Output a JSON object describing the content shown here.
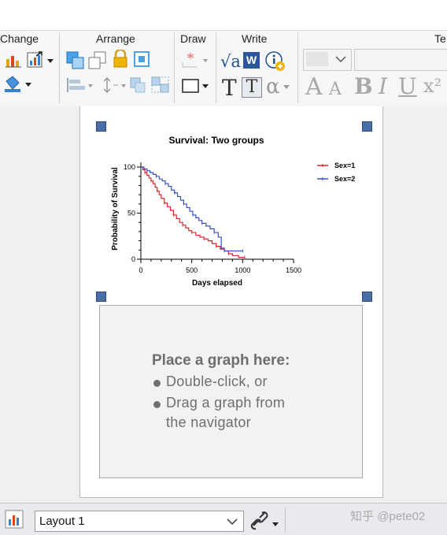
{
  "ribbon": {
    "groups": {
      "change": "Change",
      "arrange": "Arrange",
      "draw": "Draw",
      "write": "Write",
      "text": "Te"
    },
    "write_buttons": {
      "sqrt": "√a",
      "word": "W",
      "info": "i"
    },
    "text_buttons": {
      "big_t": "T",
      "boxed_t": "T",
      "alpha": "α",
      "grow_a": "A",
      "shrink_a": "A",
      "bold": "B",
      "italic": "I",
      "underline": "U",
      "superscript": "x²"
    }
  },
  "graph": {
    "title": "Survival: Two groups",
    "legend": [
      {
        "label": "Sex=1",
        "color": "#d62728"
      },
      {
        "label": "Sex=2",
        "color": "#3b4fc4"
      }
    ]
  },
  "chart_data": {
    "type": "line",
    "title": "Survival: Two groups",
    "xlabel": "Days elapsed",
    "ylabel": "Probability of Survival",
    "xlim": [
      0,
      1500
    ],
    "ylim": [
      0,
      100
    ],
    "xticks": [
      0,
      500,
      1000,
      1500
    ],
    "yticks": [
      0,
      50,
      100
    ],
    "legend_position": "top-right",
    "step": true,
    "series": [
      {
        "name": "Sex=1",
        "color": "#d62728",
        "x": [
          0,
          20,
          40,
          60,
          80,
          100,
          120,
          140,
          160,
          180,
          200,
          230,
          260,
          290,
          320,
          350,
          380,
          410,
          440,
          470,
          500,
          540,
          580,
          620,
          660,
          700,
          740,
          780,
          820,
          860,
          900,
          960,
          1020
        ],
        "y": [
          100,
          97,
          94,
          91,
          88,
          85,
          82,
          78,
          74,
          70,
          66,
          61,
          57,
          53,
          48,
          44,
          40,
          37,
          34,
          31,
          29,
          26,
          24,
          22,
          20,
          17,
          14,
          11,
          9,
          6,
          4,
          2,
          2
        ]
      },
      {
        "name": "Sex=2",
        "color": "#3b4fc4",
        "x": [
          0,
          30,
          60,
          90,
          120,
          150,
          180,
          210,
          240,
          270,
          300,
          330,
          360,
          390,
          420,
          450,
          480,
          510,
          540,
          570,
          600,
          640,
          680,
          720,
          760,
          790,
          820,
          880,
          940,
          1000
        ],
        "y": [
          100,
          98,
          96,
          94,
          92,
          90,
          87,
          85,
          82,
          79,
          75,
          72,
          68,
          64,
          60,
          56,
          52,
          48,
          45,
          42,
          39,
          36,
          33,
          29,
          24,
          12,
          9,
          9,
          9,
          9
        ]
      }
    ]
  },
  "placeholder": {
    "title": "Place a graph here:",
    "bullet1": "Double-click, or",
    "bullet2a": "Drag a graph from",
    "bullet2b": "the navigator"
  },
  "bottom": {
    "layout_value": "Layout 1",
    "watermark": "知乎 @pete02"
  }
}
